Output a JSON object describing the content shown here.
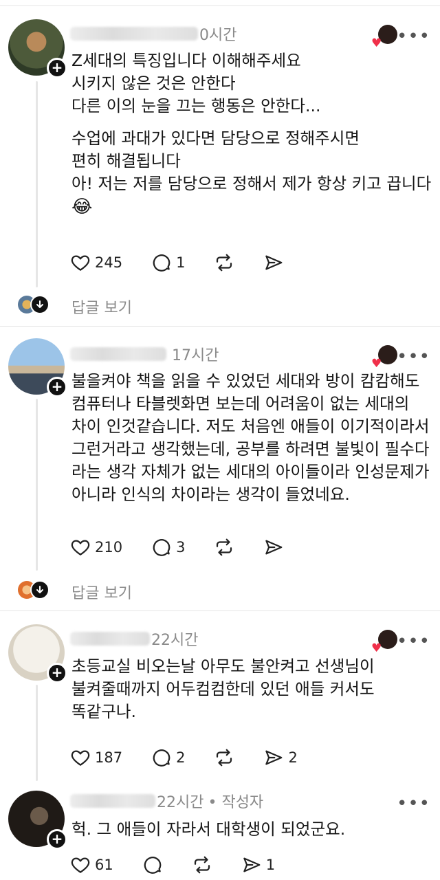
{
  "posts": [
    {
      "time": "0시간",
      "lines_a": [
        "Z세대의 특징입니다 이해해주세요",
        "시키지 않은 것은 안한다",
        "다른 이의 눈을 끄는 행동은 안한다..."
      ],
      "lines_b": [
        "수업에 과대가 있다면 담당으로 정해주시면",
        "편히 해결됩니다",
        "아! 저는 저를 담당으로 정해서 제가 항상 키고 끕니다"
      ],
      "emoji": "😂",
      "likes": "245",
      "replies": "1",
      "view_replies": "답글 보기"
    },
    {
      "time": "17시간",
      "lines_a": [
        "불을켜야 책을 읽을 수 있었던 세대와 방이 캄캄해도",
        "컴퓨터나 타블렛화면 보는데 어려움이 없는 세대의",
        "차이 인것같습니다. 저도 처음엔 애들이 이기적이라서",
        "그런거라고 생각했는데, 공부를 하려면 불빛이 필수다",
        "라는 생각 자체가 없는 세대의 아이들이라 인성문제가",
        "아니라 인식의 차이라는 생각이 들었네요."
      ],
      "likes": "210",
      "replies": "3",
      "view_replies": "답글 보기"
    },
    {
      "time": "22시간",
      "lines_a": [
        "초등교실 비오는날 아무도 불안켜고 선생님이",
        "불켜줄때까지 어두컴컴한데 있던 애들 커서도",
        "똑같구나."
      ],
      "likes": "187",
      "replies": "2",
      "shares": "2"
    },
    {
      "time": "22시간",
      "author_tag": "• 작성자",
      "lines_a": [
        "헉. 그 애들이 자라서 대학생이 되었군요."
      ],
      "likes": "61",
      "shares": "1"
    }
  ],
  "icons": {
    "like": "heart-outline-icon",
    "reply": "speech-bubble-icon",
    "repost": "repost-arrows-icon",
    "share": "send-arrow-icon",
    "more": "more-dots-icon",
    "follow": "plus-icon",
    "expand": "arrow-down-icon"
  },
  "colors": {
    "liked_heart": "#f0304a",
    "muted": "#8a8a8a",
    "divider": "#e4e4e4"
  }
}
